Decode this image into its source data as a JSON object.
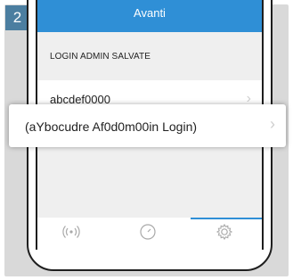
{
  "step_badge": "2",
  "header": {
    "title": "Avanti"
  },
  "section": {
    "title": "LOGIN ADMIN SALVATE"
  },
  "list": {
    "items": [
      {
        "label": "abcdef0000"
      }
    ]
  },
  "callout": {
    "label": "(aYbocudre Af0d0m00in Login)"
  },
  "tabs": [
    {
      "icon": "wireless-icon",
      "active": false
    },
    {
      "icon": "clock-icon",
      "active": false
    },
    {
      "icon": "gear-icon",
      "active": true
    }
  ],
  "colors": {
    "accent": "#2f8fd6",
    "badge": "#4b7ea0",
    "background": "#d9d9d9"
  }
}
